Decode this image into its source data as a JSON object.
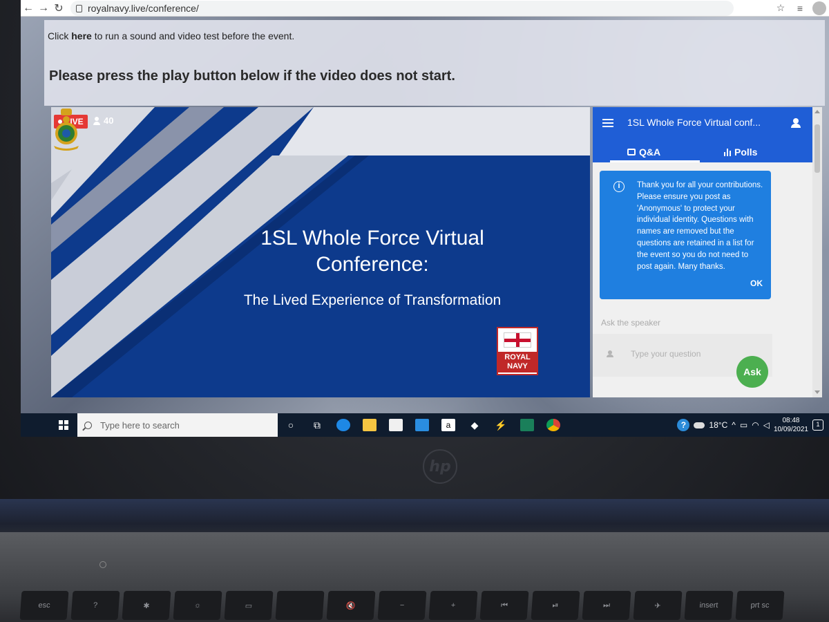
{
  "browser": {
    "url": "royalnavy.live/conference/"
  },
  "notice": {
    "line1_prefix": "Click ",
    "line1_link": "here",
    "line1_suffix": " to run a sound and video test before the event.",
    "line2": "Please press the play button below if the video does not start."
  },
  "player": {
    "live_label": "LIVE",
    "viewer_count": "40",
    "slide_title_line1": "1SL Whole Force Virtual",
    "slide_title_line2": "Conference:",
    "slide_subtitle": "The Lived Experience of Transformation",
    "logo_text_line1": "ROYAL",
    "logo_text_line2": "NAVY"
  },
  "panel": {
    "title": "1SL Whole Force Virtual conf...",
    "tabs": [
      {
        "label": "Q&A"
      },
      {
        "label": "Polls"
      }
    ],
    "info_message": "Thank you for all your contributions. Please ensure you post as 'Anonymous' to protect your individual identity. Questions with names are removed but the questions are retained in a list for the event so you do not need to post again. Many thanks.",
    "info_ok": "OK",
    "ask_label": "Ask the speaker",
    "question_placeholder": "Type your question",
    "ask_button": "Ask"
  },
  "taskbar": {
    "search_placeholder": "Type here to search",
    "weather": "18°C",
    "time": "08:48",
    "date": "10/09/2021",
    "notification_count": "1"
  },
  "laptop": {
    "fn_keys": [
      "esc",
      "?",
      "✱",
      "☼",
      "▭",
      "",
      "🔇",
      "−",
      "+",
      "⏮",
      "⏯",
      "⏭",
      "✈",
      "insert",
      "prt sc"
    ]
  },
  "colors": {
    "panel_blue": "#1f5ed6",
    "info_card_blue": "#1f7fe0",
    "ask_green": "#4caf50",
    "live_red": "#e53935",
    "slide_navy": "#0d3a8c"
  }
}
